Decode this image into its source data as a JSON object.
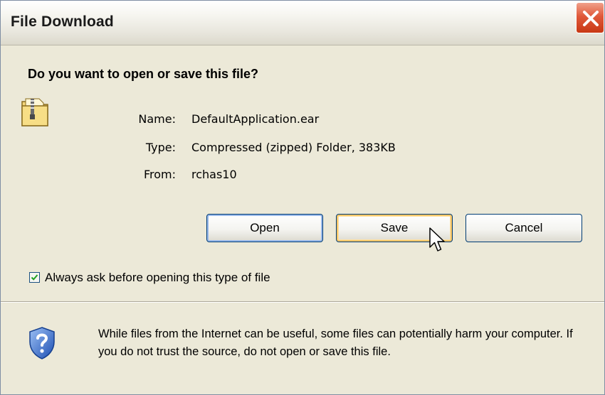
{
  "window": {
    "title": "File Download"
  },
  "question": "Do you want to open or save this file?",
  "icons": {
    "file": "zipped-folder-icon",
    "security": "shield-question-icon",
    "close": "close-icon",
    "checkmark": "checkmark-icon",
    "cursor": "mouse-pointer-icon"
  },
  "file_info": {
    "name_label": "Name:",
    "name_value": "DefaultApplication.ear",
    "type_label": "Type:",
    "type_value": "Compressed (zipped) Folder, 383KB",
    "from_label": "From:",
    "from_value": "rchas10"
  },
  "buttons": {
    "open": "Open",
    "save": "Save",
    "cancel": "Cancel"
  },
  "checkbox": {
    "label": "Always ask before opening this type of file",
    "checked": true
  },
  "warning": "While files from the Internet can be useful, some files can potentially harm your computer. If you do not trust the source, do not open or save this file.",
  "colors": {
    "dialog_bg": "#ece9d8",
    "close_red": "#e0593a",
    "button_border": "#003c74",
    "focus_orange": "#f6c567"
  }
}
